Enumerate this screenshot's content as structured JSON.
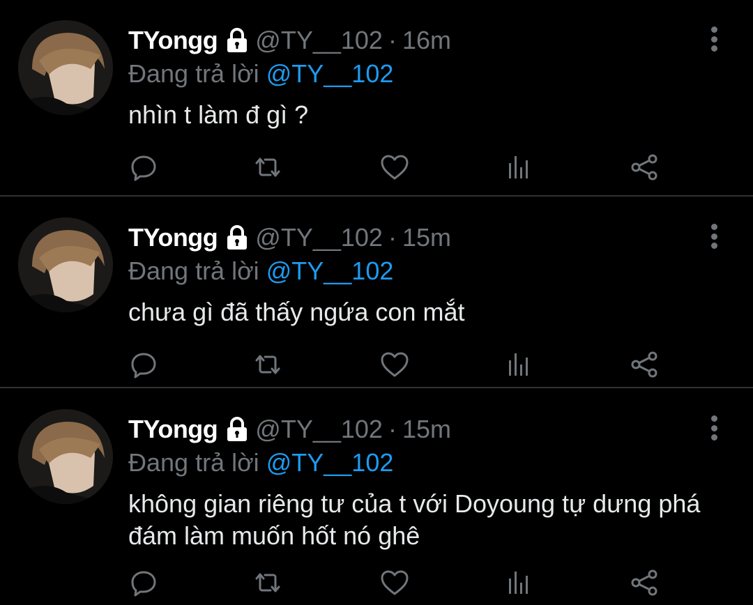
{
  "colors": {
    "background": "#000000",
    "text_primary": "#e7e9ea",
    "text_secondary": "#71767b",
    "accent_link": "#1d9bf0",
    "divider": "#2f3336"
  },
  "tweets": [
    {
      "display_name": "TYongg",
      "handle": "@TY__102",
      "separator": "·",
      "time": "16m",
      "reply_prefix": "Đang trả lời",
      "reply_to": "@TY__102",
      "text": "nhìn t làm đ gì ?",
      "icons": [
        "lock-icon",
        "more-vertical-icon",
        "reply-icon",
        "retweet-icon",
        "like-icon",
        "stats-icon",
        "share-icon"
      ]
    },
    {
      "display_name": "TYongg",
      "handle": "@TY__102",
      "separator": "·",
      "time": "15m",
      "reply_prefix": "Đang trả lời",
      "reply_to": "@TY__102",
      "text": "chưa gì đã thấy ngứa con mắt",
      "icons": [
        "lock-icon",
        "more-vertical-icon",
        "reply-icon",
        "retweet-icon",
        "like-icon",
        "stats-icon",
        "share-icon"
      ]
    },
    {
      "display_name": "TYongg",
      "handle": "@TY__102",
      "separator": "·",
      "time": "15m",
      "reply_prefix": "Đang trả lời",
      "reply_to": "@TY__102",
      "text": "không gian riêng tư của t với Doyoung tự dưng phá đám làm muốn hốt nó ghê",
      "icons": [
        "lock-icon",
        "more-vertical-icon",
        "reply-icon",
        "retweet-icon",
        "like-icon",
        "stats-icon",
        "share-icon"
      ]
    }
  ]
}
